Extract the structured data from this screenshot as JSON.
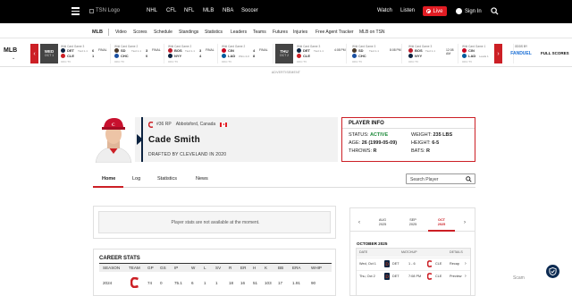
{
  "topnav": {
    "logo_alt": "TSN Logo",
    "links": [
      "NHL",
      "CFL",
      "NFL",
      "MLB",
      "NBA",
      "Soccer"
    ],
    "watch": "Watch",
    "listen": "Listen",
    "live": "Live",
    "signin": "Sign In"
  },
  "subnav": {
    "league": "MLB",
    "items": [
      "Video",
      "Scores",
      "Schedule",
      "Standings",
      "Statistics",
      "Leaders",
      "Teams",
      "Futures",
      "Injuries",
      "Free Agent Tracker",
      "MLB on TSN"
    ]
  },
  "scores": {
    "league": "MLB",
    "days": [
      {
        "label": "WED",
        "date": "OCT 1"
      },
      {
        "label": "THU",
        "date": "OCT 2"
      }
    ],
    "games": [
      {
        "hdr": "Wild Card Game 3",
        "status": "FINAL",
        "t1": "DET",
        "t1rec": "Tied 1-1",
        "s1": "6",
        "t2": "CLE",
        "t2rec": "",
        "s2": "1",
        "c1": "#0c2340",
        "c2": "#cc1f25",
        "ftr": "OKC TV"
      },
      {
        "hdr": "Wild Card Game 2",
        "status": "FINAL",
        "t1": "SD",
        "t1rec": "Tied 1-1",
        "s1": "3",
        "t2": "CHC",
        "t2rec": "",
        "s2": "0",
        "c1": "#4a3a2a",
        "c2": "#1a4fa0",
        "ftr": "OKC TV"
      },
      {
        "hdr": "Wild Card Game 2",
        "status": "FINAL",
        "t1": "BOS",
        "t1rec": "Tied 1-1",
        "s1": "3",
        "t2": "NYY",
        "t2rec": "",
        "s2": "4",
        "c1": "#bd1e2d",
        "c2": "#0c2340",
        "ftr": "OKC TV"
      },
      {
        "hdr": "Wild Card Game 2",
        "status": "FINAL",
        "t1": "CIN",
        "t1rec": "",
        "s1": "4",
        "t2": "LAD",
        "t2rec": "Wins 2-0",
        "s2": "8",
        "c1": "#c6011f",
        "c2": "#005a9c",
        "ftr": "OKC TV"
      },
      {
        "hdr": "Wild Card Game 3",
        "status": "4:08 PM",
        "t1": "DET",
        "t1rec": "Tied 1-1",
        "s1": "",
        "t2": "CLE",
        "t2rec": "",
        "s2": "",
        "c1": "#0c2340",
        "c2": "#cc1f25",
        "ftr": "OKC TV"
      },
      {
        "hdr": "Wild Card Game 3",
        "status": "8:08 PM",
        "t1": "SD",
        "t1rec": "Tied 1-1",
        "s1": "",
        "t2": "CHC",
        "t2rec": "",
        "s2": "",
        "c1": "#4a3a2a",
        "c2": "#1a4fa0",
        "ftr": "OKC TV"
      },
      {
        "hdr": "Wild Card Game 3",
        "status": "12:08 AM",
        "t1": "BOS",
        "t1rec": "Tied 1-1",
        "s1": "",
        "t2": "NYY",
        "t2rec": "",
        "s2": "",
        "c1": "#bd1e2d",
        "c2": "#0c2340",
        "ftr": "OKC TV"
      },
      {
        "hdr": "Wild Card Game 1",
        "status": "",
        "t1": "CIN",
        "t1rec": "",
        "s1": "",
        "t2": "LAD",
        "t2rec": "Leads 1",
        "s2": "",
        "c1": "#c6011f",
        "c2": "#005a9c",
        "ftr": "OKC TV"
      }
    ],
    "odds_label": "ODDS BY",
    "fanduel": "FANDUEL",
    "full_scores": "FULL SCORES"
  },
  "advertisement": "ADVERTISEMENT",
  "player": {
    "number_pos": "#36 RP",
    "hometown": "Abbotsford, Canada",
    "name": "Cade Smith",
    "drafted": "DRAFTED BY CLEVELAND IN 2020"
  },
  "player_info": {
    "title": "PLAYER INFO",
    "status_label": "STATUS:",
    "status_value": "ACTIVE",
    "age_label": "AGE:",
    "age_value": "26 (1999-05-09)",
    "throws_label": "THROWS:",
    "throws_value": "R",
    "weight_label": "WEIGHT:",
    "weight_value": "235 LBS",
    "height_label": "HEIGHT:",
    "height_value": "6-5",
    "bats_label": "BATS:",
    "bats_value": "R"
  },
  "tabs": [
    "Home",
    "Log",
    "Statistics",
    "News"
  ],
  "search_placeholder": "Search Player",
  "nostats_msg": "Player stats are not available at the moment.",
  "career": {
    "title": "CAREER STATS",
    "headers": [
      "SEASON",
      "TEAM",
      "GP",
      "GS",
      "IP",
      "W",
      "L",
      "SV",
      "R",
      "ER",
      "H",
      "K",
      "BB",
      "ERA",
      "WHIP"
    ],
    "row": [
      "2024",
      "",
      "74",
      "0",
      "75.1",
      "6",
      "1",
      "1",
      "18",
      "16",
      "51",
      "103",
      "17",
      "1.91",
      "90"
    ]
  },
  "schedule": {
    "months": [
      {
        "m": "AUG",
        "y": "2025"
      },
      {
        "m": "SEP",
        "y": "2025"
      },
      {
        "m": "OCT",
        "y": "2025"
      }
    ],
    "month_title": "OCTOBER 2025",
    "headers": [
      "DATE",
      "MATCHUP",
      "DETAILS"
    ],
    "rows": [
      {
        "date": "Wed, Oct 1",
        "away": "DET",
        "mid": "1 - 6",
        "home": "CLE",
        "detail": "Recap"
      },
      {
        "date": "Thu, Oct 2",
        "away": "DET",
        "mid": "7:08 PM",
        "home": "CLE",
        "detail": "Preview"
      }
    ]
  },
  "watermark": "Scam"
}
